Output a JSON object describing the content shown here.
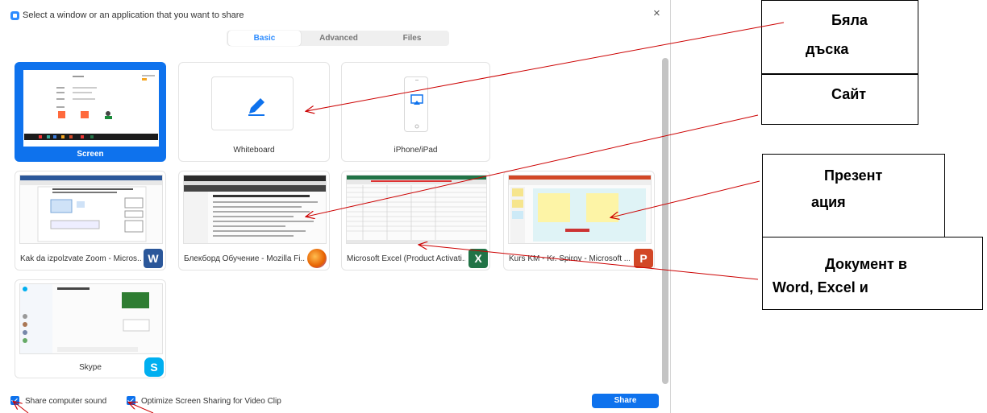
{
  "dialog": {
    "title": "Select a window or an application that you want to share",
    "close": "×",
    "tabs": [
      {
        "label": "Basic",
        "active": true
      },
      {
        "label": "Advanced",
        "active": false
      },
      {
        "label": "Files",
        "active": false
      }
    ],
    "tiles": [
      {
        "label": "Screen",
        "selected": true
      },
      {
        "label": "Whiteboard",
        "selected": false
      },
      {
        "label": "iPhone/iPad",
        "selected": false
      },
      {
        "label": "Kak da izpolzvate Zoom - Micros...",
        "badge": "W",
        "badge_color": "#2b579a"
      },
      {
        "label": "Блекборд Обучение - Mozilla Fi...",
        "badge": "firefox",
        "badge_color": "#e66000"
      },
      {
        "label": "Microsoft Excel (Product Activati...",
        "badge": "X",
        "badge_color": "#217346"
      },
      {
        "label": "Kurs KM - Kr. Spirov - Microsoft ...",
        "badge": "P",
        "badge_color": "#d24726"
      },
      {
        "label": "Skype",
        "badge": "S",
        "badge_color": "#00aff0"
      }
    ],
    "footer": {
      "share_sound_label": "Share computer sound",
      "optimize_label": "Optimize Screen Sharing for Video Clip",
      "share_button": "Share"
    }
  },
  "annotations": {
    "whiteboard_line1": "Бяла",
    "whiteboard_line2": "дъска",
    "site": "Сайт",
    "presentation_line1": "Презент",
    "presentation_line2": "ация",
    "document_line1": "Документ в",
    "document_line2": "Word, Excel и"
  },
  "colors": {
    "accent": "#0e72ed",
    "arrow": "#cc0000"
  }
}
